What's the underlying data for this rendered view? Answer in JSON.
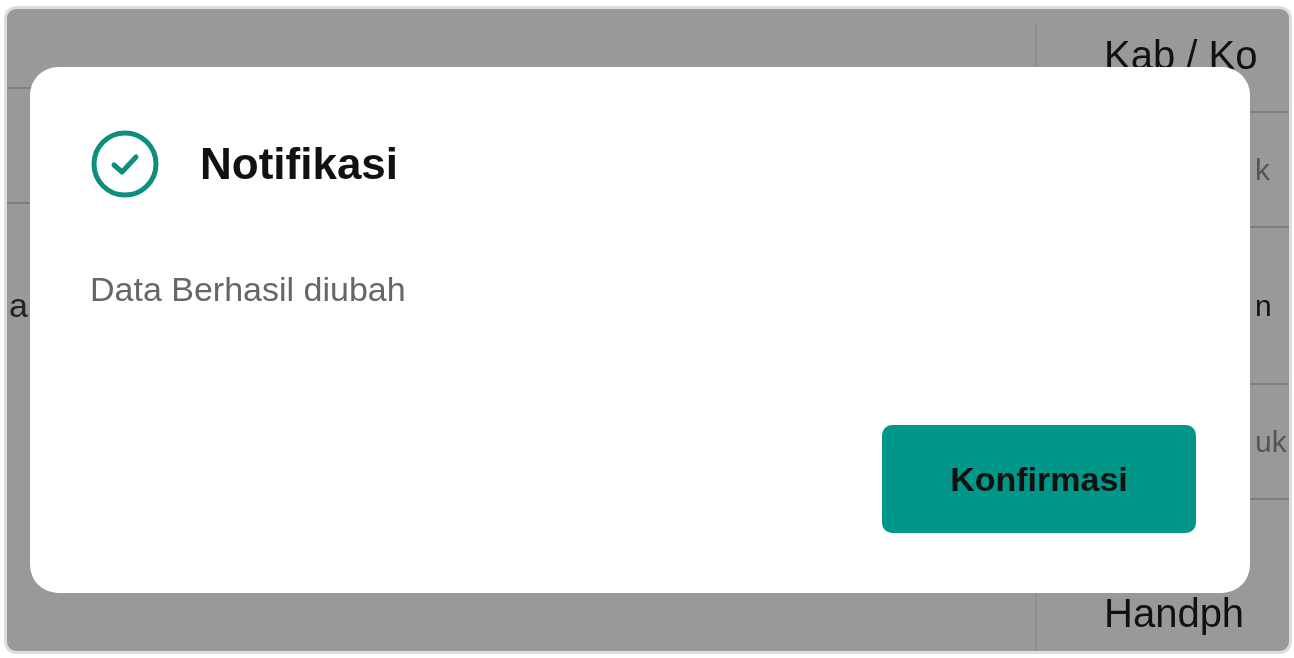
{
  "background": {
    "left_fragments": [
      {
        "text": "a"
      }
    ],
    "right_fields": [
      {
        "kind": "label",
        "text": "Kab / Ko"
      },
      {
        "kind": "cut_value",
        "text": "k"
      },
      {
        "kind": "cut_label",
        "text": "n"
      },
      {
        "kind": "cut_value",
        "text": "uk"
      },
      {
        "kind": "label",
        "text": "Handph"
      }
    ]
  },
  "dialog": {
    "title": "Notifikasi",
    "message": "Data Berhasil diubah",
    "buttons": [
      "Konfirmasi"
    ]
  }
}
